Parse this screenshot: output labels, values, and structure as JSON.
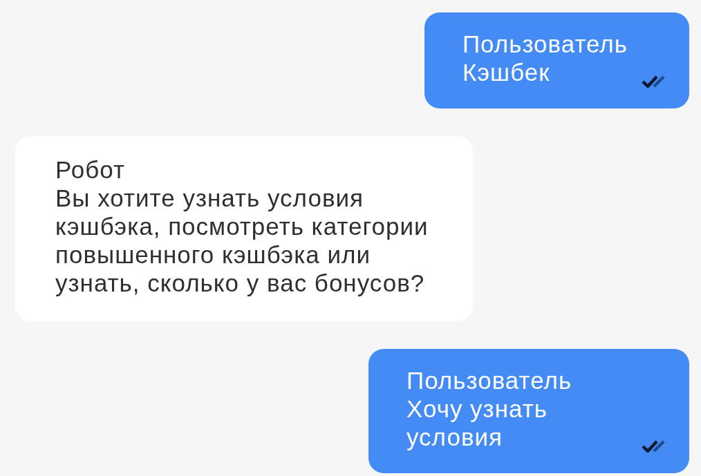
{
  "messages": [
    {
      "kind": "outgoing",
      "author": "Пользователь",
      "text": "Кэшбек",
      "read": true
    },
    {
      "kind": "incoming",
      "author": "Робот",
      "text": "Вы хотите узнать условия кэшбэка, посмотреть категории повышенного кэшбэка или узнать, сколько у вас бонусов?"
    },
    {
      "kind": "outgoing",
      "author": "Пользователь",
      "text": "Хочу узнать условия",
      "read": true
    }
  ]
}
